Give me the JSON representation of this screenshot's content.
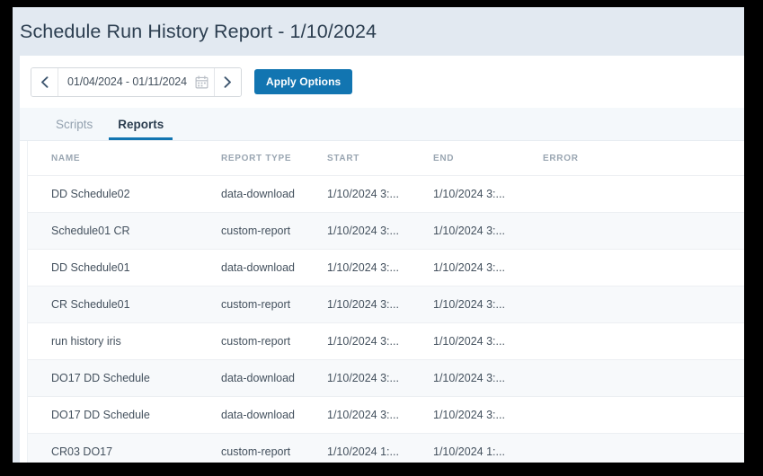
{
  "window": {
    "background_color": "#e2e9f1",
    "frame_color": "#000000",
    "card_color": "#ffffff"
  },
  "header": {
    "title": "Schedule Run History Report - 1/10/2024"
  },
  "toolbar": {
    "prev_label": "‹",
    "next_label": "›",
    "date_range_value": "01/04/2024 - 01/11/2024",
    "date_range_placeholder": "MM/DD/YYYY - MM/DD/YYYY",
    "calendar_icon": "calendar-icon",
    "apply_label": "Apply Options",
    "apply_color": "#1275b1"
  },
  "tabs": [
    {
      "label": "Scripts",
      "active": false
    },
    {
      "label": "Reports",
      "active": true
    }
  ],
  "tabs_accent_color": "#1275b1",
  "table": {
    "columns": [
      {
        "key": "name",
        "label": "NAME"
      },
      {
        "key": "type",
        "label": "REPORT TYPE"
      },
      {
        "key": "start",
        "label": "START"
      },
      {
        "key": "end",
        "label": "END"
      },
      {
        "key": "error",
        "label": "ERROR"
      }
    ],
    "rows": [
      {
        "name": "DD Schedule02",
        "type": "data-download",
        "start": "1/10/2024 3:...",
        "end": "1/10/2024 3:...",
        "error": ""
      },
      {
        "name": "Schedule01 CR",
        "type": "custom-report",
        "start": "1/10/2024 3:...",
        "end": "1/10/2024 3:...",
        "error": ""
      },
      {
        "name": "DD Schedule01",
        "type": "data-download",
        "start": "1/10/2024 3:...",
        "end": "1/10/2024 3:...",
        "error": ""
      },
      {
        "name": "CR Schedule01",
        "type": "custom-report",
        "start": "1/10/2024 3:...",
        "end": "1/10/2024 3:...",
        "error": ""
      },
      {
        "name": "run history iris",
        "type": "custom-report",
        "start": "1/10/2024 3:...",
        "end": "1/10/2024 3:...",
        "error": ""
      },
      {
        "name": "DO17 DD Schedule",
        "type": "data-download",
        "start": "1/10/2024 3:...",
        "end": "1/10/2024 3:...",
        "error": ""
      },
      {
        "name": "DO17 DD Schedule",
        "type": "data-download",
        "start": "1/10/2024 3:...",
        "end": "1/10/2024 3:...",
        "error": ""
      },
      {
        "name": "CR03 DO17",
        "type": "custom-report",
        "start": "1/10/2024 1:...",
        "end": "1/10/2024 1:...",
        "error": ""
      }
    ]
  }
}
